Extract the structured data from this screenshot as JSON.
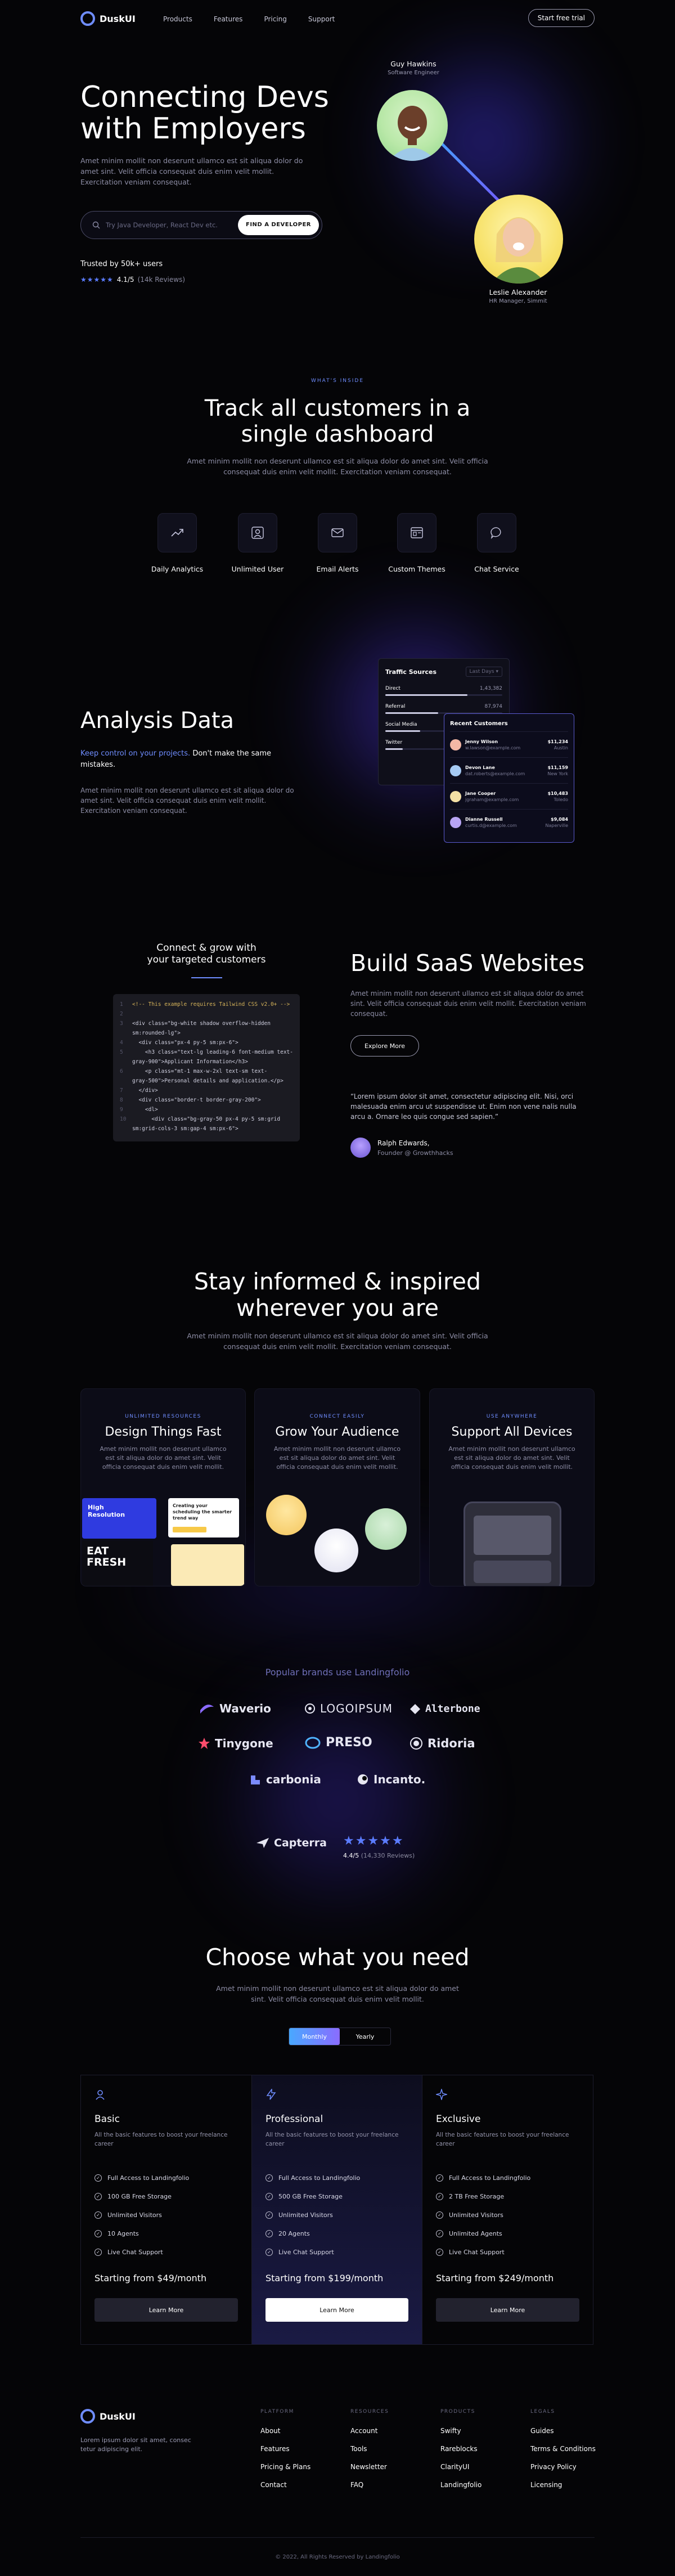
{
  "nav": {
    "brand": "DuskUI",
    "links": [
      "Products",
      "Features",
      "Pricing",
      "Support"
    ],
    "cta": "Start free trial"
  },
  "hero": {
    "title": "Connecting Devs with Employers",
    "paragraph": "Amet minim mollit non deserunt ullamco est sit aliqua dolor do amet sint. Velit officia consequat duis enim velit mollit. Exercitation veniam consequat.",
    "search_placeholder": "Try Java Developer, React Dev etc.",
    "search_button": "FIND A DEVELOPER",
    "trusted": "Trusted by 50k+ users",
    "rating_value": "4.1/5",
    "rating_count": "(14k Reviews)",
    "rating_stars": 4.1,
    "person1_name": "Guy Hawkins",
    "person1_role": "Software Engineer",
    "person2_name": "Leslie Alexander",
    "person2_role": "HR Manager, Simmit"
  },
  "dashboard": {
    "eyebrow": "WHAT'S INSIDE",
    "title_line1": "Track all customers in a",
    "title_line2": "single dashboard",
    "paragraph_line1": "Amet minim mollit non deserunt ullamco est sit aliqua dolor do amet sint. Velit officia",
    "paragraph_line2": "consequat duis enim velit mollit. Exercitation veniam consequat.",
    "features": [
      "Daily Analytics",
      "Unlimited User",
      "Email Alerts",
      "Custom Themes",
      "Chat Service"
    ]
  },
  "analysis": {
    "title": "Analysis Data",
    "highlight": "Keep control on your projects.",
    "highlight_rest": "Don't make the same mistakes.",
    "paragraph": "Amet minim mollit non deserunt ullamco est sit aliqua dolor do amet sint. Velit officia consequat duis enim velit mollit. Exercitation veniam consequat.",
    "traffic_title": "Traffic Sources",
    "traffic_period": "Last Days",
    "traffic_rows": [
      {
        "name": "Direct",
        "value": "1,43,382",
        "fill": 0.7
      },
      {
        "name": "Referral",
        "value": "87,974",
        "fill": 0.45
      },
      {
        "name": "Social Media",
        "value": "45,211",
        "fill": 0.3
      },
      {
        "name": "Twitter",
        "value": "21,893",
        "fill": 0.15
      }
    ],
    "customers_title": "Recent Customers",
    "customers": [
      {
        "name": "Jenny Wilson",
        "email": "w.lawson@example.com",
        "amount": "$11,234",
        "place": "Austin"
      },
      {
        "name": "Devon Lane",
        "email": "dat.roberts@example.com",
        "amount": "$11,159",
        "place": "New York"
      },
      {
        "name": "Jane Cooper",
        "email": "jgraham@example.com",
        "amount": "$10,483",
        "place": "Toledo"
      },
      {
        "name": "Dianne Russell",
        "email": "curtis.d@example.com",
        "amount": "$9,084",
        "place": "Naperville"
      }
    ]
  },
  "saas": {
    "code_heading_line1": "Connect & grow with",
    "code_heading_line2": "your targeted customers",
    "code_lines": [
      {
        "n": "1",
        "t": "<!-- This example requires Tailwind CSS v2.0+ -->"
      },
      {
        "n": "2",
        "t": ""
      },
      {
        "n": "3",
        "t": "<div class=\"bg-white shadow overflow-hidden"
      },
      {
        "n": "",
        "t": "sm:rounded-lg\">"
      },
      {
        "n": "4",
        "t": "  <div class=\"px-4 py-5 sm:px-6\">"
      },
      {
        "n": "5",
        "t": "    <h3 class=\"text-lg leading-6 font-medium text-"
      },
      {
        "n": "",
        "t": "gray-900\">Applicant Information</h3>"
      },
      {
        "n": "6",
        "t": "    <p class=\"mt-1 max-w-2xl text-sm text-"
      },
      {
        "n": "",
        "t": "gray-500\">Personal details and application.</p>"
      },
      {
        "n": "7",
        "t": "  </div>"
      },
      {
        "n": "8",
        "t": "  <div class=\"border-t border-gray-200\">"
      },
      {
        "n": "9",
        "t": "    <dl>"
      },
      {
        "n": "10",
        "t": "      <div class=\"bg-gray-50 px-4 py-5 sm:grid"
      },
      {
        "n": "",
        "t": "sm:grid-cols-3 sm:gap-4 sm:px-6\">"
      }
    ],
    "title": "Build SaaS Websites",
    "paragraph": "Amet minim mollit non deserunt ullamco est sit aliqua dolor do amet sint. Velit officia consequat duis enim velit mollit. Exercitation veniam consequat.",
    "button": "Explore More",
    "quote": "“Lorem ipsum dolor sit amet, consectetur adipiscing elit. Nisi, orci malesuada enim arcu ut suspendisse ut. Enim non vene nalis nulla arcu a. Ornare leo quis congue sed sapien.”",
    "quote_name": "Ralph Edwards,",
    "quote_role": "Founder @ Growthhacks"
  },
  "inspired": {
    "title_line1": "Stay informed & inspired",
    "title_line2": "wherever you are",
    "paragraph_line1": "Amet minim mollit non deserunt ullamco est sit aliqua dolor do amet sint. Velit officia",
    "paragraph_line2": "consequat duis enim velit mollit. Exercitation veniam consequat.",
    "cards": [
      {
        "eyebrow": "UNLIMITED RESOURCES",
        "title": "Design Things Fast",
        "text": "Amet minim mollit non deserunt ullamco est sit aliqua dolor do amet sint. Velit officia consequat duis enim velit mollit."
      },
      {
        "eyebrow": "CONNECT EASILY",
        "title": "Grow Your Audience",
        "text": "Amet minim mollit non deserunt ullamco est sit aliqua dolor do amet sint. Velit officia consequat duis enim velit mollit."
      },
      {
        "eyebrow": "USE ANYWHERE",
        "title": "Support All Devices",
        "text": "Amet minim mollit non deserunt ullamco est sit aliqua dolor do amet sint. Velit officia consequat duis enim velit mollit."
      }
    ],
    "thumb1_title": "High Resolution",
    "thumb2_title": "Creating your scheduling the smarter trend way",
    "thumb3_title": "EAT FRESH"
  },
  "brands": {
    "heading": "Popular brands use Landingfolio",
    "names": [
      "Waverio",
      "LOGOIPSUM",
      "Alterbone",
      "Tinygone",
      "PRESO",
      "Ridoria",
      "carbonia",
      "Incanto."
    ],
    "capterra": "Capterra",
    "capterra_score": "4.4/5",
    "capterra_reviews": "(14,330 Reviews)",
    "capterra_stars": 4.4
  },
  "pricing": {
    "title": "Choose what you need",
    "paragraph_line1": "Amet minim mollit non deserunt ullamco est sit aliqua dolor do amet",
    "paragraph_line2": "sint. Velit officia consequat duis enim velit mollit.",
    "toggle_monthly": "Monthly",
    "toggle_yearly": "Yearly",
    "plans": [
      {
        "name": "Basic",
        "desc": "All the basic features to boost your freelance career",
        "features": [
          "Full Access to Landingfolio",
          "100 GB Free Storage",
          "Unlimited Visitors",
          "10 Agents",
          "Live Chat Support"
        ],
        "price": "Starting from $49/month",
        "button": "Learn More"
      },
      {
        "name": "Professional",
        "desc": "All the basic features to boost your freelance career",
        "features": [
          "Full Access to Landingfolio",
          "500 GB Free Storage",
          "Unlimited Visitors",
          "20 Agents",
          "Live Chat Support"
        ],
        "price": "Starting from $199/month",
        "button": "Learn More"
      },
      {
        "name": "Exclusive",
        "desc": "All the basic features to boost your freelance career",
        "features": [
          "Full Access to Landingfolio",
          "2 TB Free Storage",
          "Unlimited Visitors",
          "Unlimited Agents",
          "Live Chat Support"
        ],
        "price": "Starting from $249/month",
        "button": "Learn More"
      }
    ]
  },
  "footer": {
    "brand": "DuskUI",
    "tagline": "Lorem ipsum dolor sit amet, consec tetur adipiscing elit.",
    "columns": [
      {
        "heading": "PLATFORM",
        "items": [
          "About",
          "Features",
          "Pricing & Plans",
          "Contact"
        ]
      },
      {
        "heading": "RESOURCES",
        "items": [
          "Account",
          "Tools",
          "Newsletter",
          "FAQ"
        ]
      },
      {
        "heading": "PRODUCTS",
        "items": [
          "Swifty",
          "Rareblocks",
          "ClarityUI",
          "Landingfolio"
        ]
      },
      {
        "heading": "LEGALS",
        "items": [
          "Guides",
          "Terms & Conditions",
          "Privacy Policy",
          "Licensing"
        ]
      }
    ],
    "copyright": "© 2022, All Rights Reserved by Landingfolio"
  },
  "colors": {
    "accent": "#6f8dff",
    "glow": "#4b3bd6",
    "bg": "#050507"
  }
}
